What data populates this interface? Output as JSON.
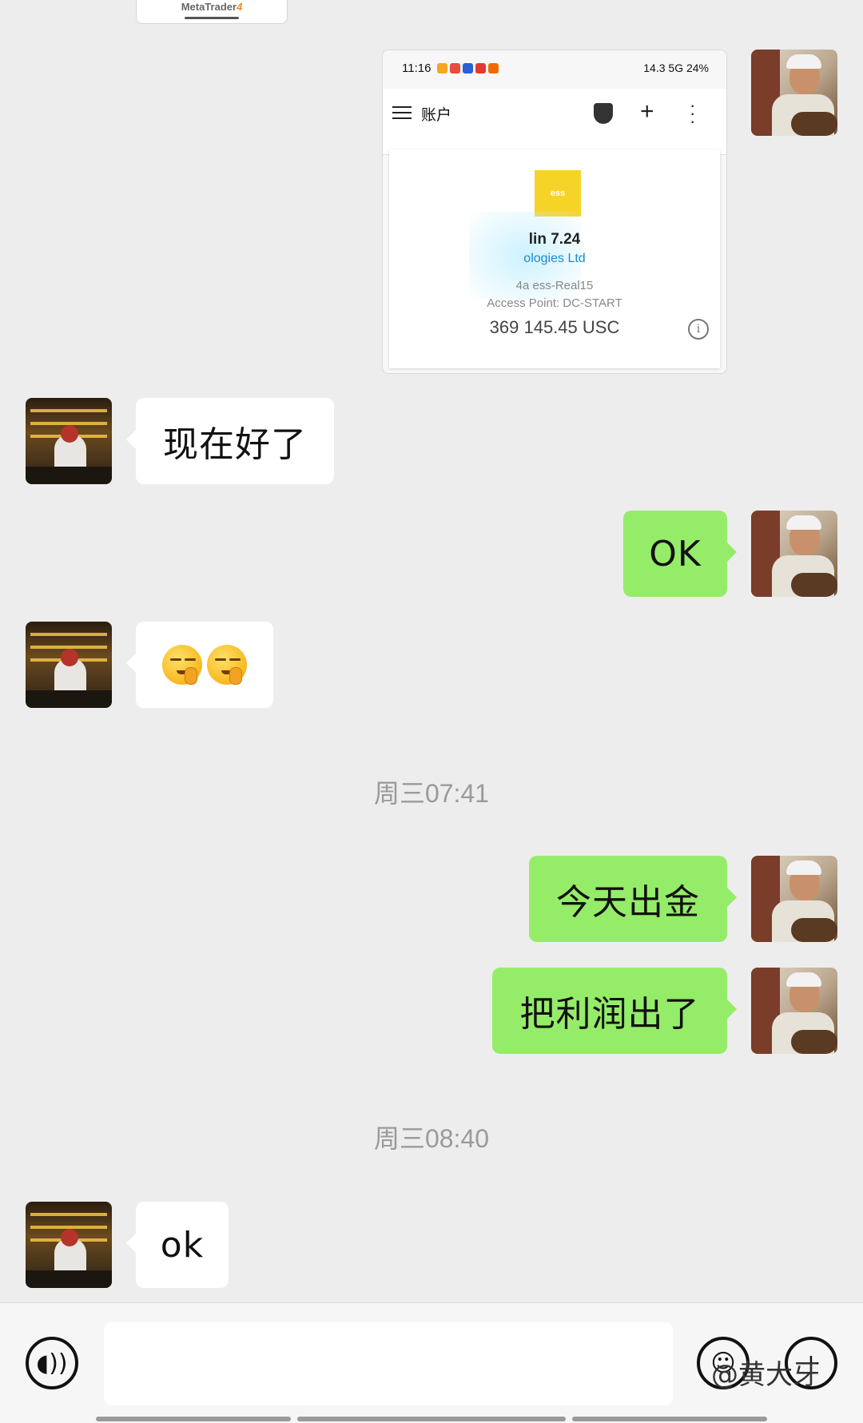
{
  "top_card": {
    "label_main": "MetaTrader",
    "label_num": "4"
  },
  "screenshot": {
    "time": "11:16",
    "status_right": "14.3 5G  24%",
    "toolbar_title": "账户",
    "line1": "lin 7.24",
    "line2": "ologies Ltd",
    "line3": "4a ess-Real15",
    "line4": "Access Point: DC-START",
    "balance": "369 145.45 USC",
    "logo_text": "ess"
  },
  "messages": [
    {
      "side": "in",
      "text": "现在好了"
    },
    {
      "side": "out",
      "text": "OK"
    },
    {
      "side": "in",
      "text": "",
      "emoji": [
        "shush-face",
        "shush-face"
      ]
    },
    {
      "side": "out",
      "text": "今天出金"
    },
    {
      "side": "out",
      "text": "把利润出了"
    },
    {
      "side": "in",
      "text": "ok"
    }
  ],
  "timestamps": [
    "周三07:41",
    "周三08:40"
  ],
  "input_bar": {
    "placeholder": "",
    "watermark": "@黄大牙",
    "icons": [
      "voice-icon",
      "emoji-icon",
      "plus-icon"
    ]
  }
}
